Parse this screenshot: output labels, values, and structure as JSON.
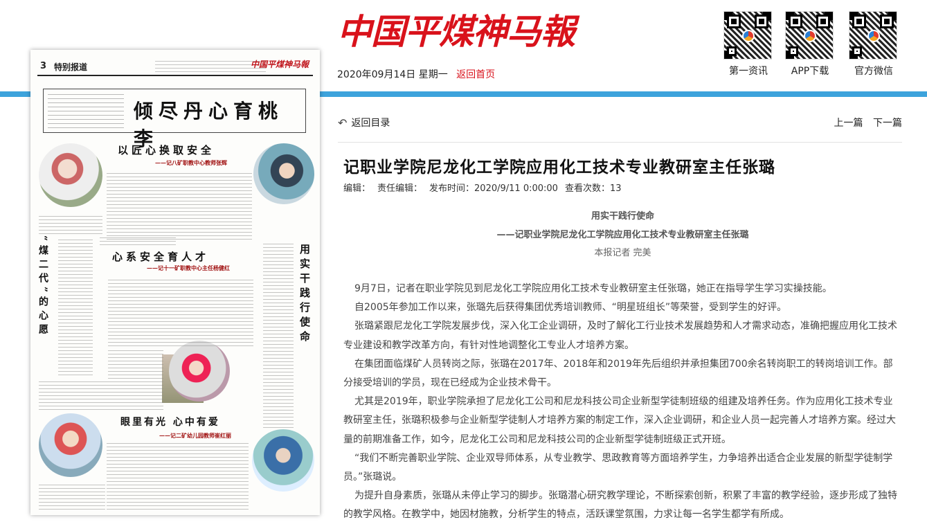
{
  "header": {
    "logo_text": "中国平煤神马報",
    "date": "2020年09月14日 星期一",
    "home_link": "返回首页",
    "qr_codes": [
      {
        "label": "第一资讯",
        "icon": "qr-code-icon"
      },
      {
        "label": "APP下载",
        "icon": "qr-code-icon"
      },
      {
        "label": "官方微信",
        "icon": "qr-code-icon"
      }
    ],
    "accent_color": "#d9121b",
    "bar_color": "#3da3dc"
  },
  "paper": {
    "page_num": "3",
    "section": "特别报道",
    "masthead": "中国平煤神马報",
    "banner": "倾尽丹心育桃李",
    "headline1": "以匠心换取安全",
    "sub1": "——记八矿职教中心教师张辉",
    "headline2": "心系安全育人才",
    "sub2": "——记十一矿职教中心主任杨健红",
    "headline3": "眼里有光 心中有爱",
    "sub3": "——记二矿幼儿园教师崔红丽",
    "vertical1": "“煤二代”的心愿",
    "vertical2": "用实干践行使命"
  },
  "article": {
    "back_label": "返回目录",
    "prev_label": "上一篇",
    "next_label": "下一篇",
    "title": "记职业学院尼龙化工学院应用化工技术专业教研室主任张璐",
    "meta": {
      "editor": "编辑：",
      "chief_editor": "责任编辑：",
      "published": "发布时间：2020/9/11 0:00:00",
      "views": "查看次数：13"
    },
    "subtitle1": "用实干践行使命",
    "subtitle2": "——记职业学院尼龙化工学院应用化工技术专业教研室主任张璐",
    "byline": "本报记者 完美",
    "paragraphs": [
      "9月7日，记者在职业学院见到尼龙化工学院应用化工技术专业教研室主任张璐，她正在指导学生学习实操技能。",
      "自2005年参加工作以来，张璐先后获得集团优秀培训教师、“明星班组长”等荣誉，受到学生的好评。",
      "张璐紧跟尼龙化工学院发展步伐，深入化工企业调研，及时了解化工行业技术发展趋势和人才需求动态，准确把握应用化工技术专业建设和教学改革方向，有针对性地调整化工专业人才培养方案。",
      "在集团面临煤矿人员转岗之际，张璐在2017年、2018年和2019年先后组织并承担集团700余名转岗职工的转岗培训工作。部分接受培训的学员，现在已经成为企业技术骨干。",
      "尤其是2019年，职业学院承担了尼龙化工公司和尼龙科技公司企业新型学徒制班级的组建及培养任务。作为应用化工技术专业教研室主任，张璐积极参与企业新型学徒制人才培养方案的制定工作，深入企业调研，和企业人员一起完善人才培养方案。经过大量的前期准备工作，如今，尼龙化工公司和尼龙科技公司的企业新型学徒制班级正式开班。",
      "“我们不断完善职业学院、企业双导师体系，从专业教学、思政教育等方面培养学生，力争培养出适合企业发展的新型学徒制学员。”张璐说。",
      "为提升自身素质，张璐从未停止学习的脚步。张璐潜心研究教学理论，不断探索创新，积累了丰富的教学经验，逐步形成了独特的教学风格。在教学中，她因材施教，分析学生的特点，活跃课堂氛围，力求让每一名学生都学有所成。"
    ]
  }
}
